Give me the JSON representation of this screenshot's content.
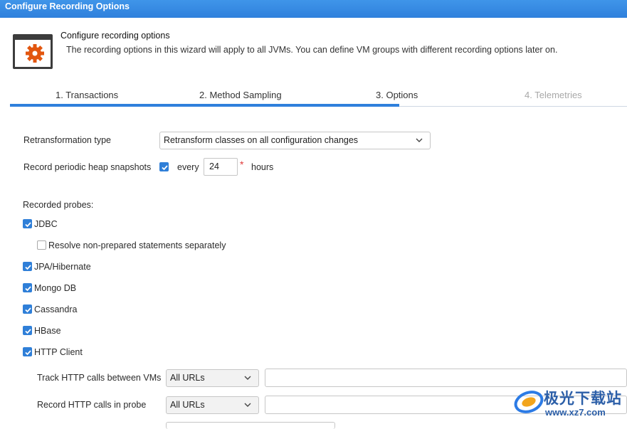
{
  "window": {
    "title": "Configure Recording Options"
  },
  "header": {
    "title": "Configure recording options",
    "description": "The recording options in this wizard will apply to all JVMs. You can define VM groups with different recording options later on.",
    "icon": "gear-icon",
    "accent": "#e2560f"
  },
  "tabs": [
    {
      "label": "1. Transactions",
      "state": "normal"
    },
    {
      "label": "2. Method Sampling",
      "state": "normal"
    },
    {
      "label": "3. Options",
      "state": "active"
    },
    {
      "label": "4. Telemetries",
      "state": "disabled"
    }
  ],
  "form": {
    "retransformation": {
      "label": "Retransformation type",
      "value": "Retransform classes on all configuration changes"
    },
    "heap": {
      "label": "Record periodic heap snapshots",
      "checked": true,
      "every_label": "every",
      "value": "24",
      "required_mark": "*",
      "unit": "hours"
    },
    "probes_label": "Recorded probes:",
    "probes": [
      {
        "label": "JDBC",
        "checked": true
      },
      {
        "label": "Resolve non-prepared statements separately",
        "checked": false,
        "indent": true
      },
      {
        "label": "JPA/Hibernate",
        "checked": true
      },
      {
        "label": "Mongo DB",
        "checked": true
      },
      {
        "label": "Cassandra",
        "checked": true
      },
      {
        "label": "HBase",
        "checked": true
      },
      {
        "label": "HTTP Client",
        "checked": true
      }
    ],
    "http_track": {
      "label": "Track HTTP calls between VMs",
      "value": "All URLs",
      "text": ""
    },
    "http_record": {
      "label": "Record HTTP calls in probe",
      "value": "All URLs",
      "text": ""
    }
  },
  "watermark": {
    "text1": "极光下载站",
    "text2": "www.xz7.com"
  },
  "colors": {
    "titlebar": "#2f80dc",
    "checkbox": "#2f7fd8",
    "tab_underline": "#2f80dc"
  }
}
